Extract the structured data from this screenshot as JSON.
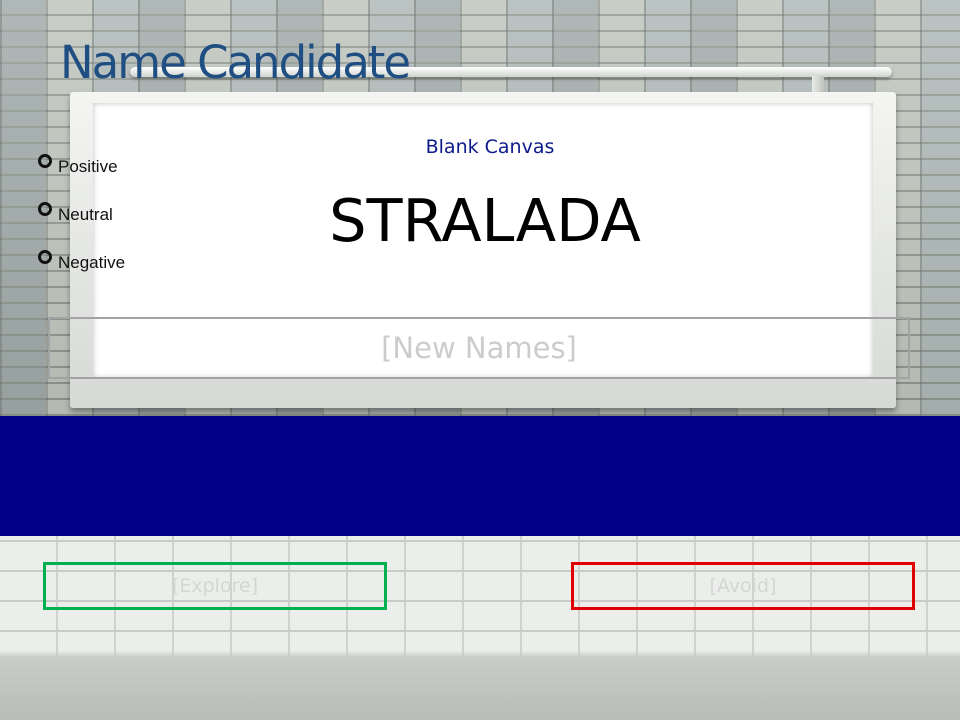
{
  "slide": {
    "title": "Name Candidate",
    "subtitle": "Blank Canvas",
    "candidate_name": "STRALADA",
    "new_names_placeholder": "[New Names]"
  },
  "sentiment_options": [
    {
      "label": "Positive"
    },
    {
      "label": "Neutral"
    },
    {
      "label": "Negative"
    }
  ],
  "zones": {
    "explore_label": "[Explore]",
    "avoid_label": "[Avoid]"
  },
  "colors": {
    "title": "#1f4e82",
    "subtitle": "#0c1a8a",
    "band": "#000088",
    "explore_border": "#00b050",
    "avoid_border": "#e00000"
  }
}
